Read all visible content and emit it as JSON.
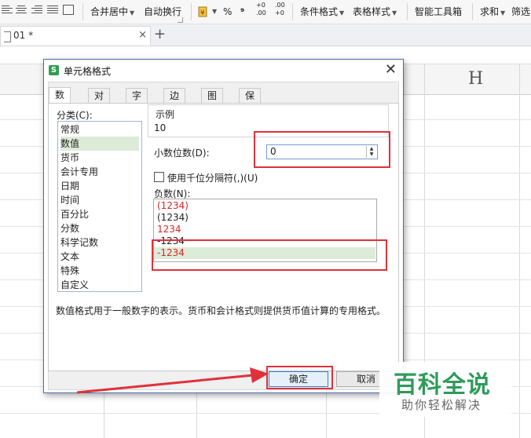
{
  "ribbon": {
    "merge_center": "合并居中",
    "auto_wrap": "自动换行",
    "percent_symbol": "%",
    "comma_symbol": "⁹",
    "increase_decimal": "+0 .00",
    "decrease_decimal": ".00 +0",
    "conditional_format": "条件格式",
    "table_style": "表格样式",
    "smart_toolbox": "智能工具箱",
    "sum": "求和",
    "filter": "筛选"
  },
  "tabbar": {
    "doc_tab_title": "01 *",
    "close_symbol": "×",
    "new_tab_symbol": "+"
  },
  "sheet": {
    "column_header": "H"
  },
  "dialog": {
    "title": "单元格格式",
    "close_symbol": "✕",
    "tabs": [
      "数字",
      "对齐",
      "字体",
      "边框",
      "图案",
      "保护"
    ],
    "active_tab": "数字",
    "category_label": "分类(C):",
    "categories": [
      "常规",
      "数值",
      "货币",
      "会计专用",
      "日期",
      "时间",
      "百分比",
      "分数",
      "科学记数",
      "文本",
      "特殊",
      "自定义"
    ],
    "selected_category": "数值",
    "sample_label": "示例",
    "sample_value": "10",
    "decimal_label": "小数位数(D):",
    "decimal_value": "0",
    "thousands_label": "使用千位分隔符(,)(U)",
    "thousands_checked": false,
    "negative_label": "负数(N):",
    "negative_options": [
      {
        "text": "(1234)",
        "color": "#d9262a"
      },
      {
        "text": "(1234)",
        "color": "#222222"
      },
      {
        "text": "1234",
        "color": "#d9262a"
      },
      {
        "text": "-1234",
        "color": "#222222"
      },
      {
        "text": "-1234",
        "color": "#d9262a"
      }
    ],
    "selected_negative_index": 4,
    "description": "数值格式用于一般数字的表示。货币和会计格式则提供货币值计算的专用格式。",
    "ok_label": "确定",
    "cancel_label": "取消"
  },
  "annotations": {
    "highlight_color": "#e0313a"
  },
  "watermark": {
    "main": "百科全说",
    "sub": "助你轻松解决",
    "color": "#2f9b5a"
  }
}
